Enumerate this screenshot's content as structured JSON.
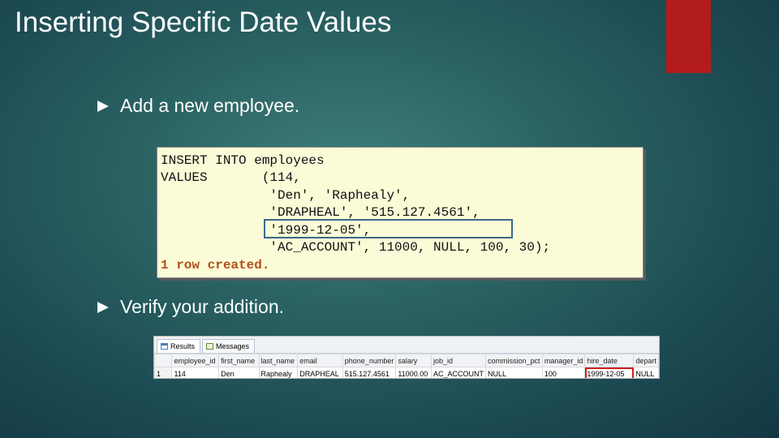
{
  "slide": {
    "title": "Inserting Specific Date Values",
    "bullets": [
      "Add a new employee.",
      "Verify your addition."
    ]
  },
  "code": {
    "lines": [
      "INSERT INTO employees",
      "VALUES       (114,",
      "              'Den', 'Raphealy',",
      "              'DRAPHEAL', '515.127.4561',",
      "              '1999-12-05',",
      "              'AC_ACCOUNT', 11000, NULL, 100, 30);"
    ],
    "result": "1 row created."
  },
  "results_grid": {
    "tabs": [
      "Results",
      "Messages"
    ],
    "columns": [
      "employee_id",
      "first_name",
      "last_name",
      "email",
      "phone_number",
      "salary",
      "job_id",
      "commission_pct",
      "manager_id",
      "hire_date",
      "depart"
    ],
    "rows": [
      [
        "1",
        "114",
        "Den",
        "Raphealy",
        "DRAPHEAL",
        "515.127.4561",
        "11000.00",
        "AC_ACCOUNT",
        "NULL",
        "100",
        "1999-12-05",
        "NULL"
      ]
    ]
  },
  "colors": {
    "accent": "#b31c1c",
    "result_text": "#b0501a",
    "highlight": "#d41b1b"
  }
}
